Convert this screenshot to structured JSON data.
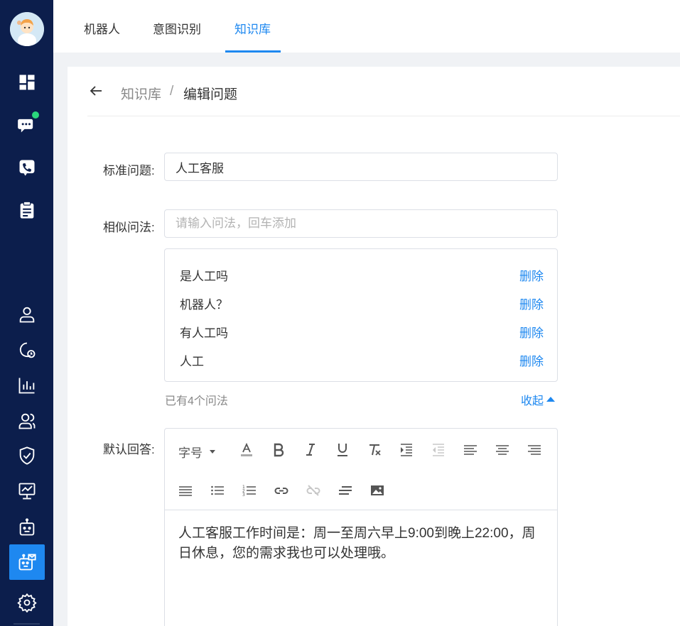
{
  "nav": {
    "tabs": [
      {
        "label": "机器人"
      },
      {
        "label": "意图识别"
      },
      {
        "label": "知识库"
      }
    ],
    "active_tab": "知识库"
  },
  "sidebar": {
    "items": [
      "dashboard-icon",
      "chat-icon",
      "phone-icon",
      "clipboard-icon",
      "user-icon",
      "clock-user-icon",
      "bar-chart-icon",
      "users-icon",
      "shield-icon",
      "monitor-chart-icon",
      "robot-icon",
      "robot-mail-icon",
      "settings-icon"
    ],
    "active_item": "robot-mail-icon",
    "notification_color": "#2ad67c"
  },
  "breadcrumb": {
    "root": "知识库",
    "separator": "/",
    "current": "编辑问题"
  },
  "form": {
    "standard_label": "标准问题:",
    "standard_value": "人工客服",
    "similar_label": "相似问法:",
    "similar_placeholder": "请输入问法，回车添加",
    "similar_items": [
      {
        "text": "是人工吗",
        "action": "删除"
      },
      {
        "text": "机器人？",
        "action": "删除"
      },
      {
        "text": "有人工吗",
        "action": "删除"
      },
      {
        "text": "人工",
        "action": "删除"
      }
    ],
    "count_text": "已有4个问法",
    "collapse_label": "收起",
    "answer_label": "默认回答:",
    "font_size_label": "字号",
    "answer_text": "人工客服工作时间是：周一至周六早上9:00到晚上22:00，周日休息，您的需求我也可以处理哦。"
  },
  "colors": {
    "sidebar_bg": "#0c1e4c",
    "accent": "#1e88f0"
  }
}
